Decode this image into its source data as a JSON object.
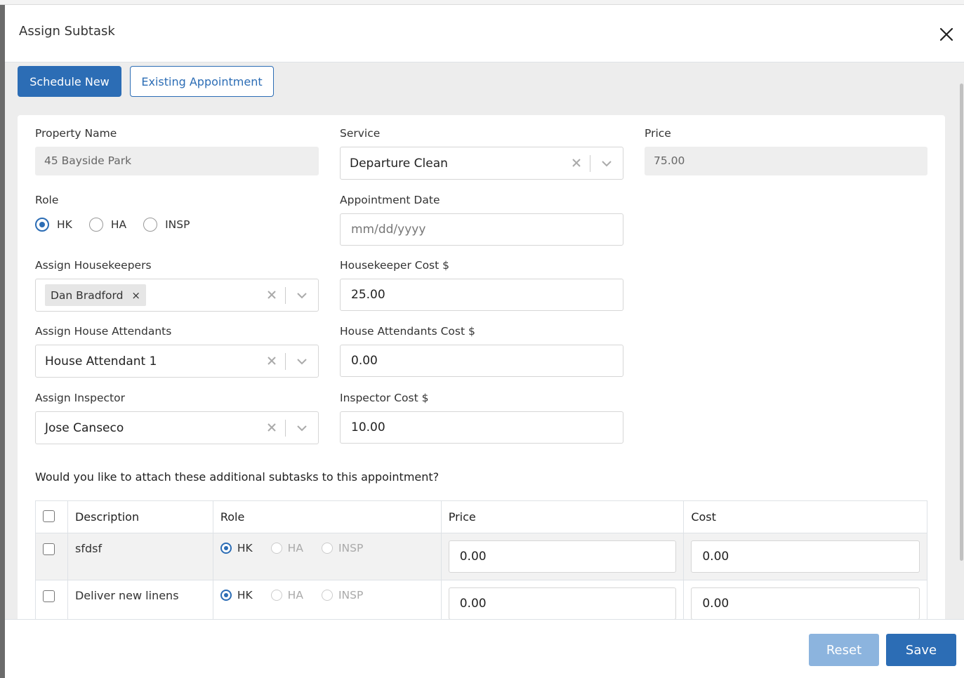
{
  "modal": {
    "title": "Assign Subtask"
  },
  "tabs": {
    "schedule_new": "Schedule New",
    "existing_appointment": "Existing Appointment"
  },
  "form": {
    "property_name": {
      "label": "Property Name",
      "value": "45 Bayside Park"
    },
    "service": {
      "label": "Service",
      "value": "Departure Clean"
    },
    "price": {
      "label": "Price",
      "value": "75.00"
    },
    "role": {
      "label": "Role",
      "options": [
        "HK",
        "HA",
        "INSP"
      ],
      "selected": "HK"
    },
    "appointment_date": {
      "label": "Appointment Date",
      "placeholder": "mm/dd/yyyy"
    },
    "assign_housekeepers": {
      "label": "Assign Housekeepers",
      "chip": "Dan Bradford",
      "chip_remove": "×"
    },
    "housekeeper_cost": {
      "label": "Housekeeper Cost $",
      "value": "25.00"
    },
    "assign_house_attendants": {
      "label": "Assign House Attendants",
      "value": "House Attendant 1"
    },
    "house_attendants_cost": {
      "label": "House Attendants Cost $",
      "value": "0.00"
    },
    "assign_inspector": {
      "label": "Assign Inspector",
      "value": "Jose Canseco"
    },
    "inspector_cost": {
      "label": "Inspector Cost $",
      "value": "10.00"
    }
  },
  "subtasks": {
    "question": "Would you like to attach these additional subtasks to this appointment?",
    "columns": {
      "description": "Description",
      "role": "Role",
      "price": "Price",
      "cost": "Cost"
    },
    "role_options": [
      "HK",
      "HA",
      "INSP"
    ],
    "rows": [
      {
        "description": "sfdsf",
        "role": "HK",
        "price": "0.00",
        "cost": "0.00"
      },
      {
        "description": "Deliver new linens",
        "role": "HK",
        "price": "0.00",
        "cost": "0.00"
      }
    ]
  },
  "footer": {
    "reset": "Reset",
    "save": "Save"
  },
  "colors": {
    "primary": "#2c6db5",
    "reset_disabled": "#8cb4de",
    "body_bg": "#ededed"
  }
}
